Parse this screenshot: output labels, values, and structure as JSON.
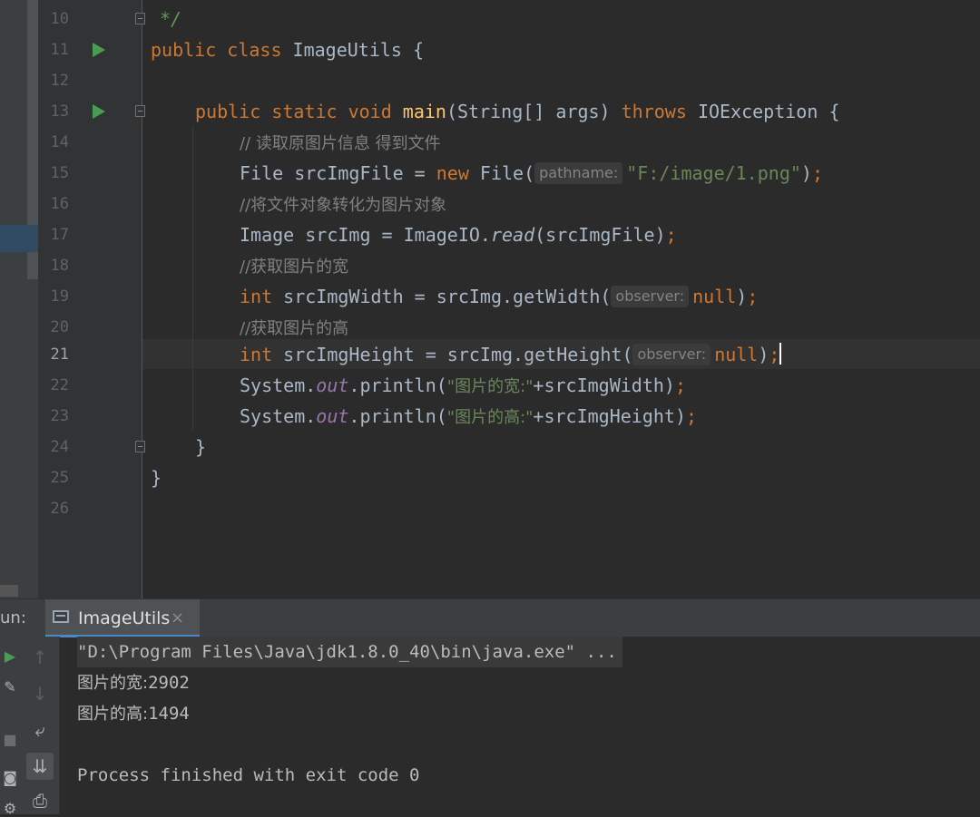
{
  "editor": {
    "lines": [
      {
        "n": "10",
        "t": {
          "comment_end": "*/"
        }
      },
      {
        "n": "11",
        "t": {
          "kw": "public class",
          "name": "ImageUtils",
          "brace": "{"
        }
      },
      {
        "n": "12"
      },
      {
        "n": "13",
        "t": {
          "kw": "public static void",
          "method": "main",
          "params": "(String[] args)",
          "throws": "throws",
          "exc": "IOException",
          "brace": "{"
        }
      },
      {
        "n": "14",
        "t": {
          "comment": "// 读取原图片信息 得到文件"
        }
      },
      {
        "n": "15",
        "t": {
          "type": "File",
          "var": " srcImgFile = ",
          "kw_new": "new",
          "ctor": " File(",
          "hint": "pathname:",
          "str": "\"F:/image/1.png\"",
          "close": ")",
          "semi": ";"
        }
      },
      {
        "n": "16",
        "t": {
          "comment": "//将文件对象转化为图片对象"
        }
      },
      {
        "n": "17",
        "t": {
          "pre": "Image srcImg = ImageIO.",
          "static_m": "read",
          "post": "(srcImgFile)",
          "semi": ";"
        }
      },
      {
        "n": "18",
        "t": {
          "comment": "//获取图片的宽"
        }
      },
      {
        "n": "19",
        "t": {
          "kw": "int",
          "var": " srcImgWidth = srcImg.getWidth(",
          "hint": "observer:",
          "null": "null",
          "close": ")",
          "semi": ";"
        }
      },
      {
        "n": "20",
        "t": {
          "comment": "//获取图片的高"
        }
      },
      {
        "n": "21",
        "t": {
          "kw": "int",
          "var": " srcImgHeight = srcImg.getHeight(",
          "hint": "observer:",
          "null": "null",
          "close": ")",
          "semi": ";"
        }
      },
      {
        "n": "22",
        "t": {
          "pre": "System.",
          "field": "out",
          "mid": ".println(",
          "str": "\"图片的宽:\"",
          "post": "+srcImgWidth)",
          "semi": ";"
        }
      },
      {
        "n": "23",
        "t": {
          "pre": "System.",
          "field": "out",
          "mid": ".println(",
          "str": "\"图片的高:\"",
          "post": "+srcImgHeight)",
          "semi": ";"
        }
      },
      {
        "n": "24",
        "t": {
          "brace": "}"
        }
      },
      {
        "n": "25",
        "t": {
          "brace": "}"
        }
      },
      {
        "n": "26"
      }
    ]
  },
  "run_panel": {
    "label": "un:",
    "tab_label": "ImageUtils",
    "tab_close": "×",
    "output": {
      "command": "\"D:\\Program Files\\Java\\jdk1.8.0_40\\bin\\java.exe\" ...",
      "width_label": "图片的宽:",
      "width_value": "2902",
      "height_label": "图片的高:",
      "height_value": "1494",
      "exit_message": "Process finished with exit code 0"
    }
  },
  "icons": {
    "run_gutter": "run-triangle-icon",
    "fold": "fold-icon",
    "scroll_up": "arrow-up-icon",
    "scroll_down": "arrow-down-icon",
    "soft_wrap": "soft-wrap-icon",
    "scroll_to_end": "scroll-to-end-icon",
    "print": "print-icon"
  },
  "colors": {
    "background": "#2b2b2b",
    "keyword": "#cc7832",
    "method_decl": "#ffc66d",
    "string": "#6a8759",
    "comment": "#808080",
    "static_field": "#9876aa",
    "line_number": "#606366",
    "run_icon": "#499c54"
  }
}
